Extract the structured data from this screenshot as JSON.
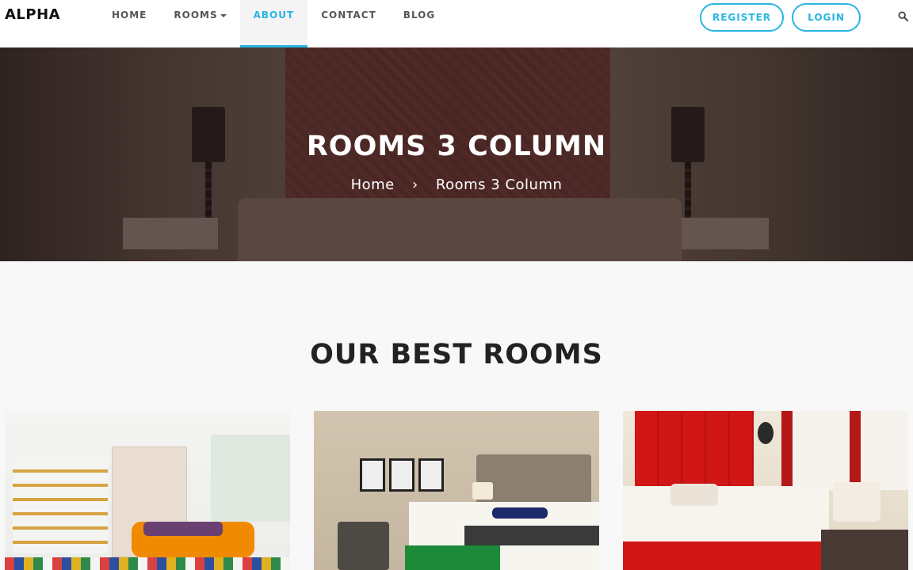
{
  "header": {
    "logo": "ALPHA",
    "nav": [
      {
        "label": "HOME",
        "active": false
      },
      {
        "label": "ROOMS",
        "active": false,
        "dropdown": true
      },
      {
        "label": "ABOUT",
        "active": true
      },
      {
        "label": "CONTACT",
        "active": false
      },
      {
        "label": "BLOG",
        "active": false
      }
    ],
    "register_label": "REGISTER",
    "login_label": "LOGIN",
    "search_icon": "search-icon"
  },
  "hero": {
    "title": "ROOMS 3 COLUMN",
    "breadcrumb": {
      "home": "Home",
      "separator": "›",
      "current": "Rooms 3 Column"
    }
  },
  "section": {
    "title": "OUR BEST ROOMS"
  },
  "colors": {
    "accent": "#27b5e3",
    "page_background": "#f8f8f8",
    "heading": "#222222"
  }
}
